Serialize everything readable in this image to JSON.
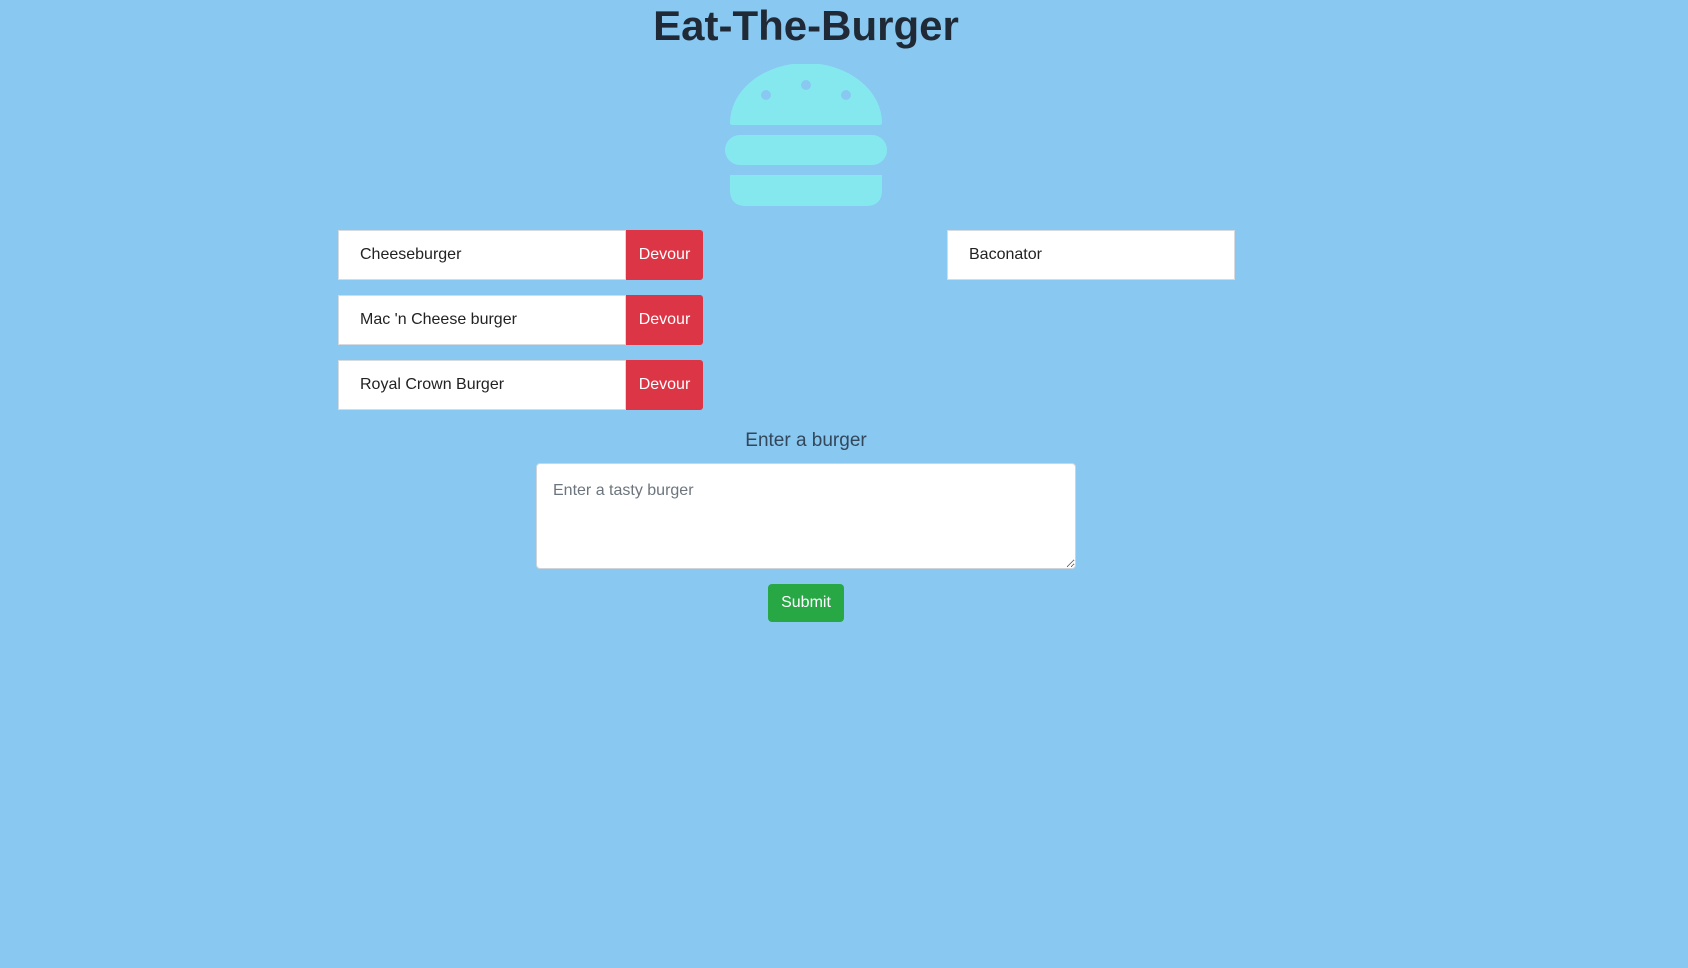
{
  "header": {
    "title": "Eat-The-Burger",
    "logo_icon": "burger-icon",
    "logo_color": "#86e8ef"
  },
  "uneaten_burgers": [
    {
      "name": "Cheeseburger",
      "action_label": "Devour"
    },
    {
      "name": "Mac 'n Cheese burger",
      "action_label": "Devour"
    },
    {
      "name": "Royal Crown Burger",
      "action_label": "Devour"
    }
  ],
  "devoured_burgers": [
    {
      "name": "Baconator"
    }
  ],
  "form": {
    "label": "Enter a burger",
    "placeholder": "Enter a tasty burger",
    "value": "",
    "submit_label": "Submit"
  },
  "colors": {
    "background": "#89c8f1",
    "devour_button": "#dc3545",
    "submit_button": "#28a745"
  }
}
